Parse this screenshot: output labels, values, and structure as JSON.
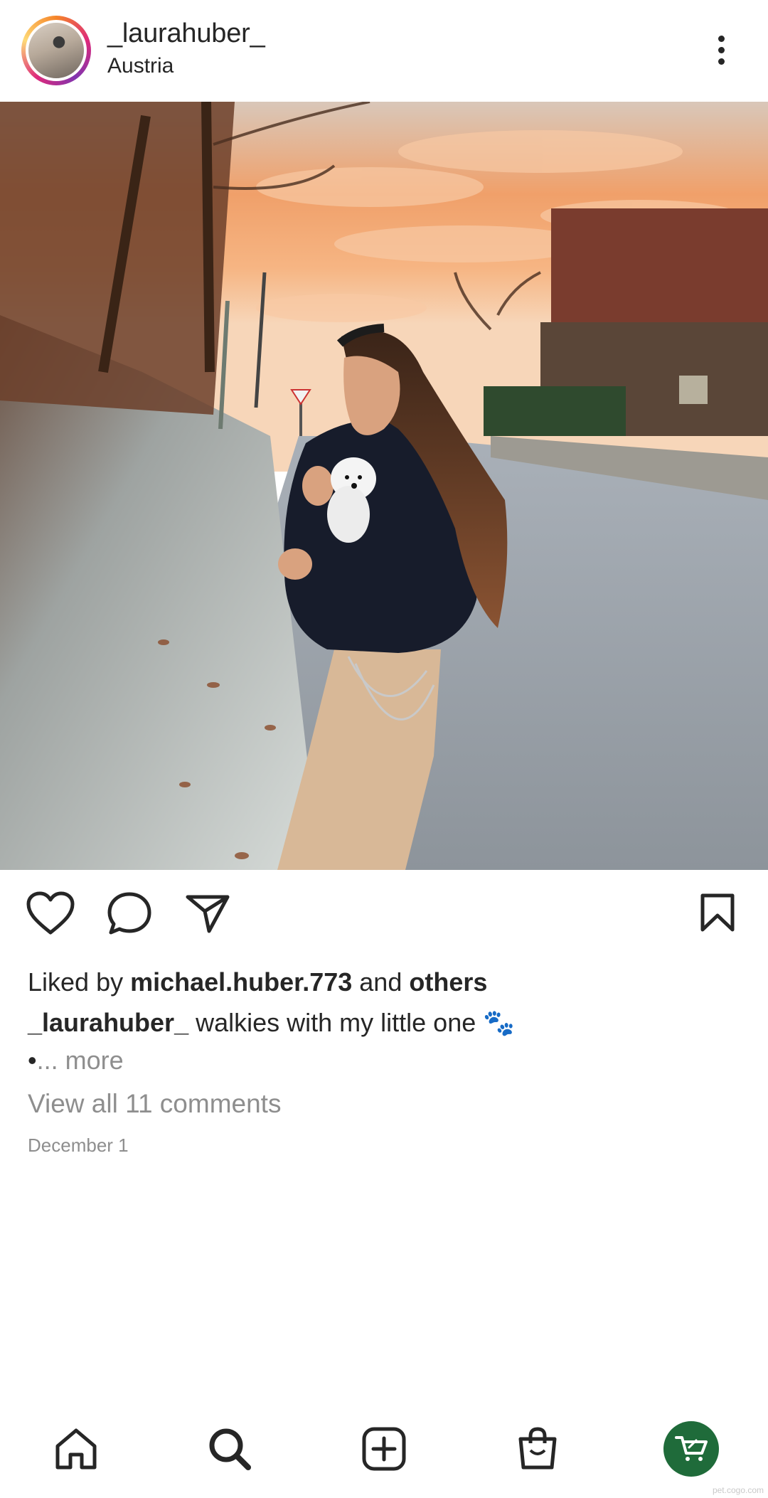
{
  "post": {
    "username": "_laurahuber_",
    "location": "Austria",
    "likes_prefix": "Liked by",
    "liked_by_user": "michael.huber.773",
    "likes_and": "and",
    "likes_others": "others",
    "caption_user": "_laurahuber_",
    "caption_text": "walkies with my little one",
    "caption_emoji": "🐾",
    "more_bullet": "•",
    "more_text": "... more",
    "view_comments": "View all 11 comments",
    "date": "December 1"
  },
  "icons": {
    "header": [
      "more-options-icon"
    ],
    "actions": [
      "heart-icon",
      "comment-icon",
      "share-icon",
      "bookmark-icon"
    ],
    "nav": [
      "home-icon",
      "search-icon",
      "add-post-icon",
      "shopping-bag-icon",
      "shop-icon"
    ]
  },
  "colors": {
    "text": "#262626",
    "muted": "#8e8e8e",
    "shop_fab": "#1f6b3a",
    "sky": "#f0a06a"
  },
  "watermark": "pet.cogo.com"
}
